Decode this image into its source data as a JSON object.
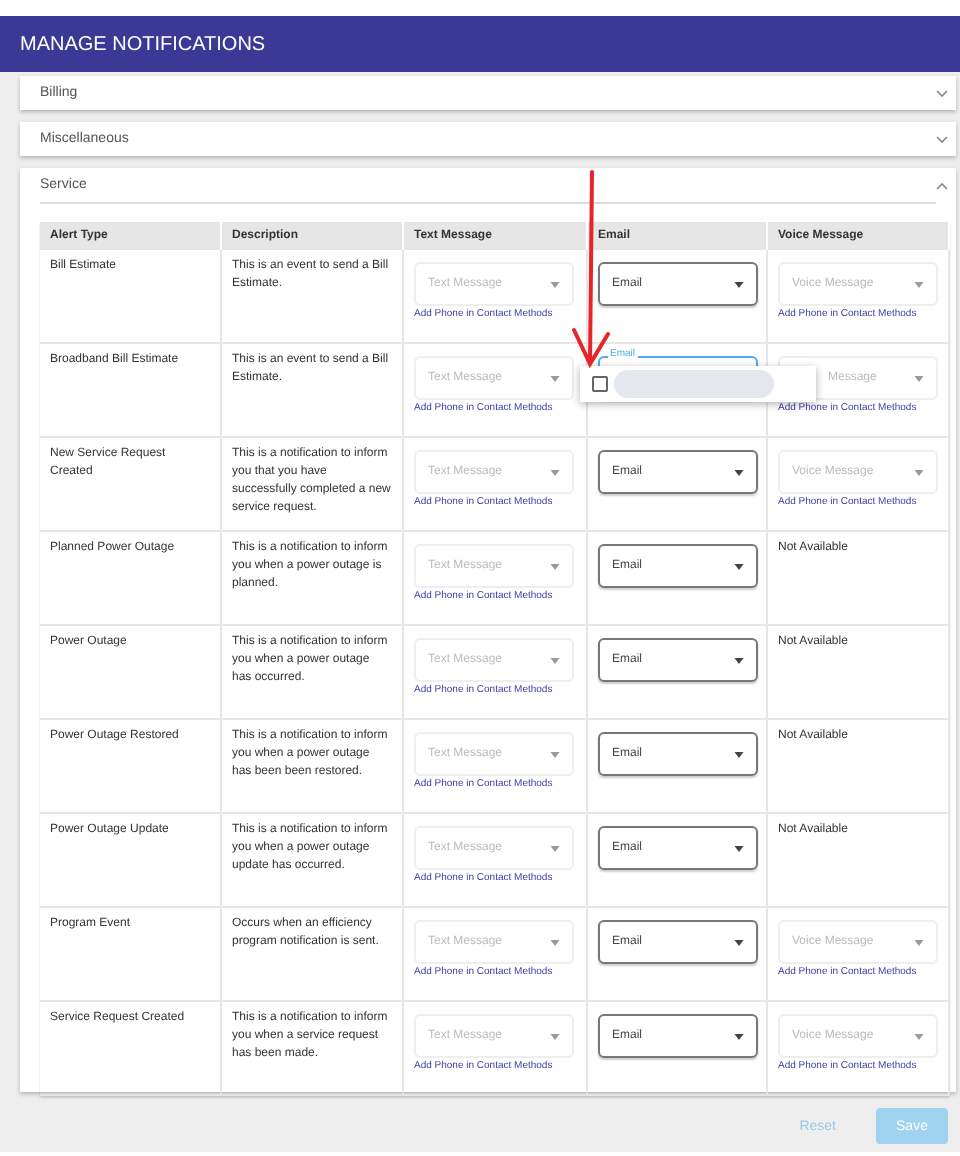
{
  "header": {
    "title": "MANAGE NOTIFICATIONS"
  },
  "sections": [
    {
      "title": "Billing",
      "expanded": false
    },
    {
      "title": "Miscellaneous",
      "expanded": false
    },
    {
      "title": "Service",
      "expanded": true
    }
  ],
  "table": {
    "columns": [
      "Alert Type",
      "Description",
      "Text Message",
      "Email",
      "Voice Message"
    ],
    "rows": [
      {
        "alert_type": "Bill Estimate",
        "description": "This is an event to send a Bill Estimate.",
        "text_message": {
          "placeholder": "Text Message",
          "link": "Add Phone in Contact Methods"
        },
        "email": {
          "value": "Email",
          "focused": false
        },
        "voice_message": {
          "kind": "select",
          "placeholder": "Voice Message",
          "link": "Add Phone in Contact Methods"
        }
      },
      {
        "alert_type": "Broadband Bill Estimate",
        "description": "This is an event to send a Bill Estimate.",
        "text_message": {
          "placeholder": "Text Message",
          "link": "Add Phone in Contact Methods"
        },
        "email": {
          "label": "Email",
          "focused": true,
          "menu": {
            "options": [
              {
                "checked": false
              }
            ]
          }
        },
        "voice_message": {
          "kind": "select",
          "placeholder": "Message",
          "link": "Add Phone in Contact Methods"
        }
      },
      {
        "alert_type": "New Service Request Created",
        "description": "This is a notification to inform you that you have successfully completed a new service request.",
        "text_message": {
          "placeholder": "Text Message",
          "link": "Add Phone in Contact Methods"
        },
        "email": {
          "value": "Email",
          "focused": false
        },
        "voice_message": {
          "kind": "select",
          "placeholder": "Voice Message",
          "link": "Add Phone in Contact Methods"
        }
      },
      {
        "alert_type": "Planned Power Outage",
        "description": "This is a notification to inform you when a power outage is planned.",
        "text_message": {
          "placeholder": "Text Message",
          "link": "Add Phone in Contact Methods"
        },
        "email": {
          "value": "Email",
          "focused": false
        },
        "voice_message": {
          "kind": "text",
          "text": "Not Available"
        }
      },
      {
        "alert_type": "Power Outage",
        "description": "This is a notification to inform you when a power outage has occurred.",
        "text_message": {
          "placeholder": "Text Message",
          "link": "Add Phone in Contact Methods"
        },
        "email": {
          "value": "Email",
          "focused": false
        },
        "voice_message": {
          "kind": "text",
          "text": "Not Available"
        }
      },
      {
        "alert_type": "Power Outage Restored",
        "description": "This is a notification to inform you when a power outage has been been restored.",
        "text_message": {
          "placeholder": "Text Message",
          "link": "Add Phone in Contact Methods"
        },
        "email": {
          "value": "Email",
          "focused": false
        },
        "voice_message": {
          "kind": "text",
          "text": "Not Available"
        }
      },
      {
        "alert_type": "Power Outage Update",
        "description": "This is a notification to inform you when a power outage update has occurred.",
        "text_message": {
          "placeholder": "Text Message",
          "link": "Add Phone in Contact Methods"
        },
        "email": {
          "value": "Email",
          "focused": false
        },
        "voice_message": {
          "kind": "text",
          "text": "Not Available"
        }
      },
      {
        "alert_type": "Program Event",
        "description": "Occurs when an efficiency program notification is sent.",
        "text_message": {
          "placeholder": "Text Message",
          "link": "Add Phone in Contact Methods"
        },
        "email": {
          "value": "Email",
          "focused": false
        },
        "voice_message": {
          "kind": "select",
          "placeholder": "Voice Message",
          "link": "Add Phone in Contact Methods"
        }
      },
      {
        "alert_type": "Service Request Created",
        "description": "This is a notification to inform you when a service request has been made.",
        "text_message": {
          "placeholder": "Text Message",
          "link": "Add Phone in Contact Methods"
        },
        "email": {
          "value": "Email",
          "focused": false
        },
        "voice_message": {
          "kind": "select",
          "placeholder": "Voice Message",
          "link": "Add Phone in Contact Methods"
        }
      }
    ]
  },
  "actions": [
    {
      "label": "Reset",
      "kind": "text"
    },
    {
      "label": "Save",
      "kind": "primary"
    }
  ]
}
